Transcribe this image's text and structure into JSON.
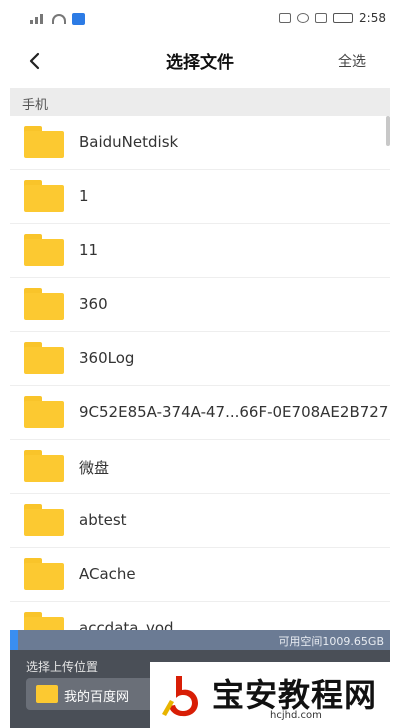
{
  "status_bar": {
    "time": "2:58"
  },
  "header": {
    "title": "选择文件",
    "select_all": "全选"
  },
  "section": {
    "label": "手机"
  },
  "files": [
    {
      "name": "BaiduNetdisk"
    },
    {
      "name": "1"
    },
    {
      "name": "11"
    },
    {
      "name": "360"
    },
    {
      "name": "360Log"
    },
    {
      "name": "9C52E85A-374A-47...66F-0E708AE2B727"
    },
    {
      "name": "微盘"
    },
    {
      "name": "abtest"
    },
    {
      "name": "ACache"
    },
    {
      "name": "accdata_vod"
    }
  ],
  "storage": {
    "text": "可用空间1009.65GB",
    "used_fraction": 0.02
  },
  "upload_panel": {
    "label": "选择上传位置",
    "destination": "我的百度网"
  },
  "watermark": {
    "title": "宝安教程网",
    "url": "hcjhd.com"
  },
  "colors": {
    "folder": "#fcc931",
    "accent": "#3a8ef0",
    "panel": "#4a4f57"
  }
}
